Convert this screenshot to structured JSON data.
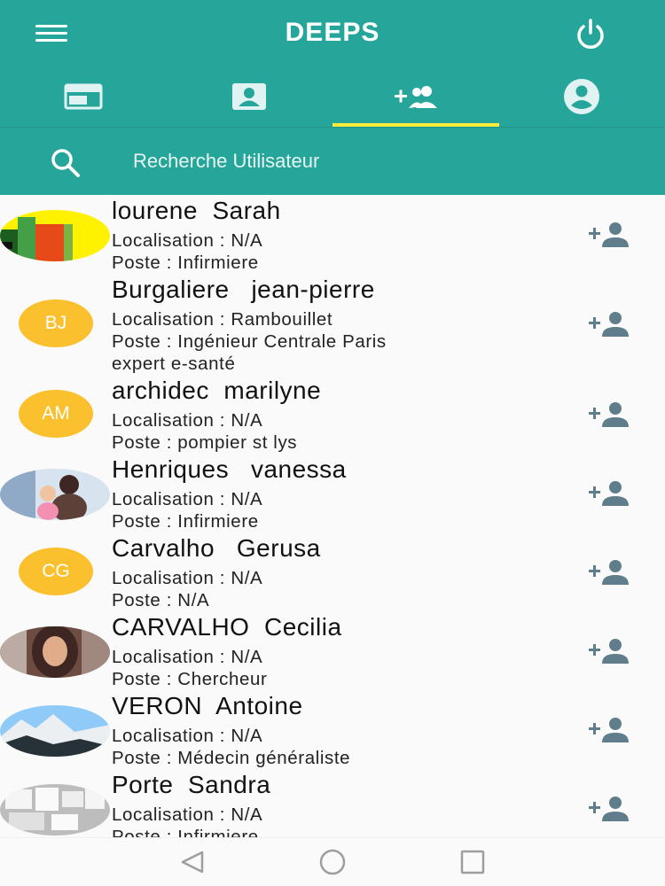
{
  "app": {
    "title": "DEEPS"
  },
  "icons": {
    "menu": "hamburger-menu-icon",
    "power": "power-icon",
    "search": "search-icon",
    "add_contact": "person-add-icon"
  },
  "colors": {
    "primary": "#26a69a",
    "accent": "#ffeb3b",
    "avatar_bg": "#fbc02d",
    "icon_gray": "#607d8b"
  },
  "tabs": [
    {
      "icon": "dashboard-icon"
    },
    {
      "icon": "contact-card-icon"
    },
    {
      "icon": "group-add-icon",
      "selected": true
    },
    {
      "icon": "account-circle-icon"
    }
  ],
  "search": {
    "placeholder": "Recherche Utilisateur"
  },
  "users": [
    {
      "name": "lourene  Sarah",
      "location": "Localisation : N/A",
      "position": "Poste : Infirmiere",
      "avatar_type": "image"
    },
    {
      "name": "Burgaliere   jean-pierre",
      "location": "Localisation : Rambouillet",
      "position": "Poste : Ingénieur Centrale Paris",
      "position_cont": "expert e-santé",
      "initials": "BJ"
    },
    {
      "name": "archidec  marilyne",
      "location": "Localisation : N/A",
      "position": "Poste : pompier st lys",
      "initials": "AM"
    },
    {
      "name": "Henriques   vanessa",
      "location": "Localisation : N/A",
      "position": "Poste : Infirmiere",
      "avatar_type": "image"
    },
    {
      "name": "Carvalho   Gerusa",
      "location": "Localisation : N/A",
      "position": "Poste : N/A",
      "initials": "CG"
    },
    {
      "name": "CARVALHO  Cecilia",
      "location": "Localisation : N/A",
      "position": "Poste : Chercheur",
      "avatar_type": "image"
    },
    {
      "name": "VERON  Antoine",
      "location": "Localisation : N/A",
      "position": "Poste : Médecin généraliste",
      "avatar_type": "image"
    },
    {
      "name": "Porte  Sandra",
      "location": "Localisation : N/A",
      "position": "Poste : Infirmiere",
      "avatar_type": "image"
    }
  ],
  "system_nav": [
    {
      "icon": "back-icon"
    },
    {
      "icon": "home-icon"
    },
    {
      "icon": "recents-icon"
    }
  ]
}
